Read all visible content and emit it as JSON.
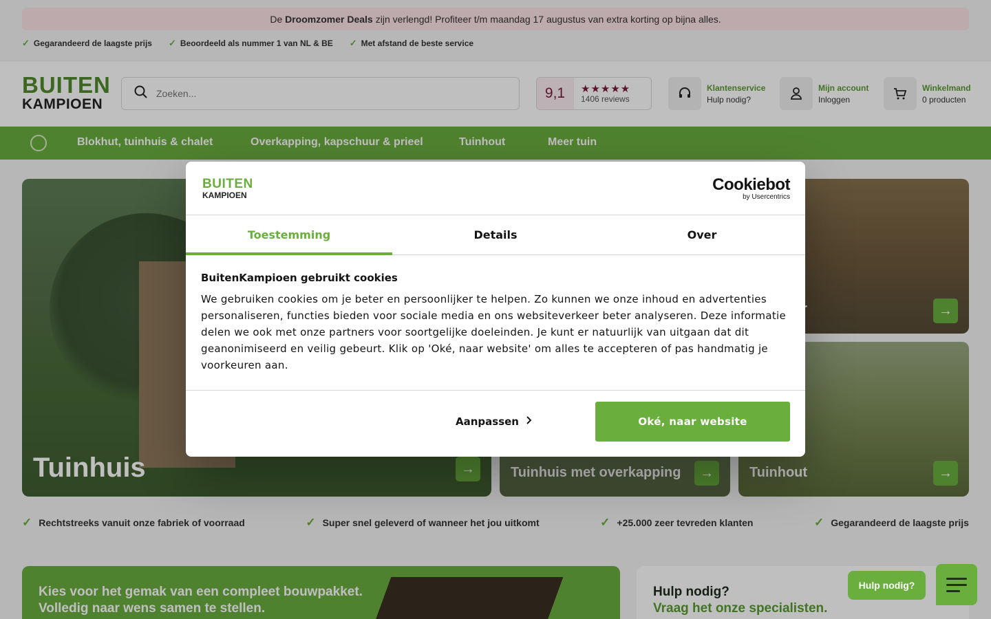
{
  "promo": {
    "prefix": "De",
    "highlight": "Droomzomer Deals",
    "rest": "zijn verlengd! Profiteer t/m maandag 17 augustus van extra korting op bijna alles."
  },
  "usps_top": [
    "Gegarandeerd de laagste prijs",
    "Beoordeeld als nummer 1 van NL & BE",
    "Met afstand de beste service"
  ],
  "logo": {
    "line1": "BUITEN",
    "line2": "KAMPIOEN"
  },
  "search": {
    "placeholder": "Zoeken..."
  },
  "rating": {
    "score": "9,1",
    "stars": "★★★★★",
    "reviews": "1406 reviews"
  },
  "header_items": [
    {
      "title": "Klantenservice",
      "sub": "Hulp nodig?",
      "icon": "headset-icon"
    },
    {
      "title": "Mijn account",
      "sub": "Inloggen",
      "icon": "user-icon"
    },
    {
      "title": "Winkelmand",
      "sub": "0 producten",
      "icon": "cart-icon"
    }
  ],
  "nav": [
    "Blokhut, tuinhuis & chalet",
    "Overkapping, kapschuur & prieel",
    "Tuinhout",
    "Meer tuin"
  ],
  "tiles": {
    "main": "Tuinhuis",
    "top_right": "ur",
    "bottom_mid": "Tuinhuis met overkapping",
    "bottom_right": "Tuinhout"
  },
  "usps_mid": [
    "Rechtstreeks vanuit onze fabriek of voorraad",
    "Super snel geleverd of wanneer het jou uitkomt",
    "+25.000 zeer tevreden klanten",
    "Gegarandeerd de laagste prijs"
  ],
  "promo_block": {
    "line1": "Kies voor het gemak van een compleet bouwpakket.",
    "line2": "Volledig naar wens samen te stellen."
  },
  "help_block": {
    "line1": "Hulp nodig?",
    "line2": "Vraag het onze specialisten."
  },
  "chat": {
    "label": "Hulp nodig?"
  },
  "cookie": {
    "logo_line1": "BUITEN",
    "logo_line2": "KAMPIOEN",
    "brand": "Cookiebot",
    "brand_sub": "by Usercentrics",
    "tabs": [
      "Toestemming",
      "Details",
      "Over"
    ],
    "active_tab": "Toestemming",
    "heading": "BuitenKampioen gebruikt cookies",
    "body": "We gebruiken cookies om je beter en persoonlijker te helpen. Zo kunnen we onze inhoud en advertenties personaliseren, functies bieden voor sociale media en ons websiteverkeer beter analyseren. Deze informatie delen we ook met onze partners voor soortgelijke doeleinden. Je kunt er natuurlijk van uitgaan dat dit geanonimiseerd en veilig gebeurt. Klik op 'Oké, naar website' om alles te accepteren of pas handmatig je voorkeuren aan.",
    "customize": "Aanpassen",
    "accept": "Oké, naar website"
  },
  "colors": {
    "brand_green": "#6aae3e",
    "rating_red": "#7a1a3a"
  }
}
